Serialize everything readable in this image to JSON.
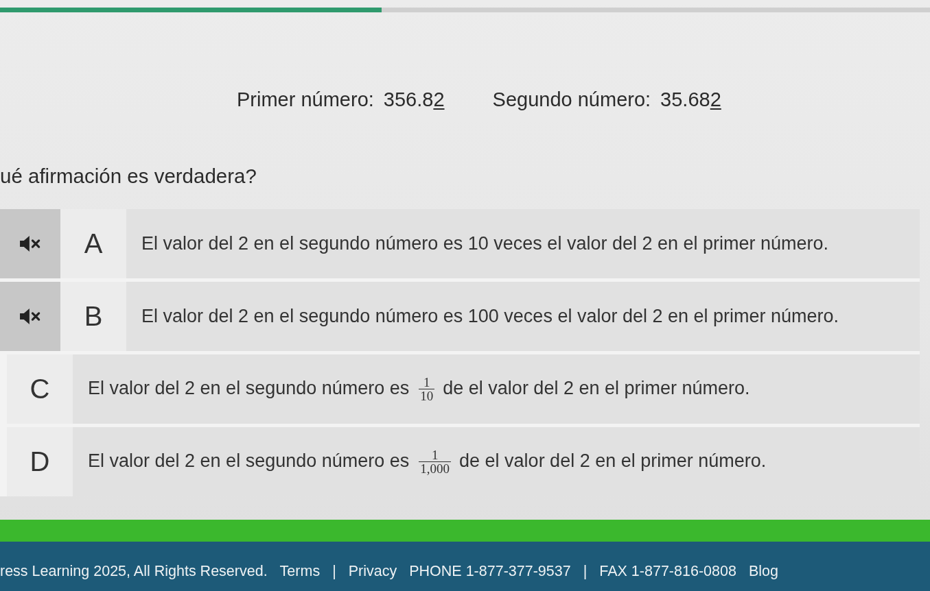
{
  "progress": {
    "level": 0.41
  },
  "numbers": [
    {
      "label": "Primer número:",
      "value": "356.8",
      "underlined_digit": "2"
    },
    {
      "label": "Segundo número:",
      "value": "35.68",
      "underlined_digit": "2"
    }
  ],
  "question": "ué afirmación es verdadera?",
  "options": [
    {
      "letter": "A",
      "audio_icon": true,
      "parts": [
        {
          "kind": "text",
          "text": "El valor del 2 en el segundo número es 10 veces el valor del 2 en el primer número."
        }
      ]
    },
    {
      "letter": "B",
      "audio_icon": true,
      "parts": [
        {
          "kind": "text",
          "text": "El valor del 2 en el segundo número es 100 veces el valor del 2 en el primer número."
        }
      ]
    },
    {
      "letter": "C",
      "audio_icon": false,
      "parts": [
        {
          "kind": "text",
          "text": "El valor del 2 en el segundo número es"
        },
        {
          "kind": "fraction",
          "numerator": "1",
          "denominator": "10"
        },
        {
          "kind": "text",
          "text": "de el valor del 2 en el primer número."
        }
      ]
    },
    {
      "letter": "D",
      "audio_icon": false,
      "parts": [
        {
          "kind": "text",
          "text": "El valor del 2 en el segundo número es"
        },
        {
          "kind": "fraction",
          "numerator": "1",
          "denominator": "1,000"
        },
        {
          "kind": "text",
          "text": "de el valor del 2 en el primer número."
        }
      ]
    }
  ],
  "footer": {
    "copyright": "ress Learning 2025, All Rights Reserved.",
    "terms_link": "Terms",
    "legal_separator": "|",
    "privacy_link": "Privacy",
    "phone": "PHONE 1-877-377-9537",
    "contact_separator": "|",
    "fax": "FAX 1-877-816-0808",
    "blog_link": "Blog"
  }
}
